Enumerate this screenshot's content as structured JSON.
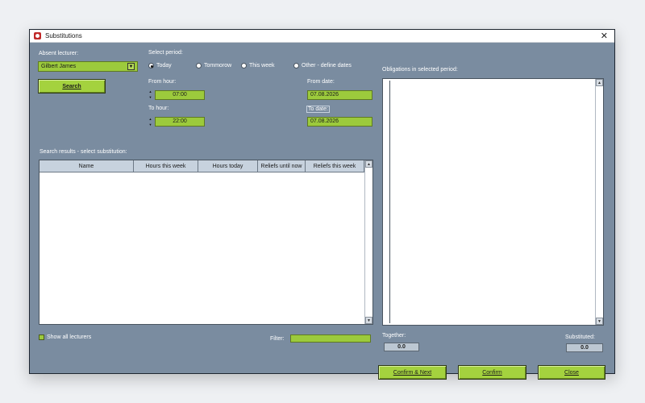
{
  "window": {
    "title": "Substitutions",
    "close_glyph": "✕"
  },
  "absent": {
    "label": "Absent lecturer:",
    "value": "Gilbert James",
    "search_label": "Search"
  },
  "period": {
    "label": "Select period:",
    "options": [
      {
        "label": "Today",
        "selected": true
      },
      {
        "label": "Tommorow",
        "selected": false
      },
      {
        "label": "This week",
        "selected": false
      },
      {
        "label": "Other - define dates",
        "selected": false
      }
    ],
    "from_hour_label": "From hour:",
    "from_hour": "07:00",
    "to_hour_label": "To hour:",
    "to_hour": "22:00",
    "from_date_label": "From date:",
    "from_date": "07.08.2026",
    "to_date_label": "To date:",
    "to_date": "07.08.2026"
  },
  "results": {
    "label": "Search results - select substitution:",
    "columns": [
      "Name",
      "Hours this week",
      "Hours today",
      "Reliefs until now",
      "Reliefs this week"
    ]
  },
  "obligations": {
    "label": "Obligations in selected period:"
  },
  "bottom": {
    "show_all_label": "Show all lecturers",
    "filter_label": "Filter:",
    "together_label": "Together:",
    "together_value": "0.0",
    "substituted_label": "Substituted:",
    "substituted_value": "0.0",
    "confirm_next_label": "Confirm & Next",
    "confirm_label": "Confirm",
    "close_label": "Close"
  },
  "colors": {
    "panel": "#7a8ca0",
    "accent": "#9cca3c",
    "header": "#c7d2de"
  },
  "icons": {
    "app": "substitutions-app-icon",
    "dropdown": "chevron-down-icon",
    "scroll_up": "scroll-up-arrow-icon",
    "scroll_down": "scroll-down-arrow-icon"
  }
}
